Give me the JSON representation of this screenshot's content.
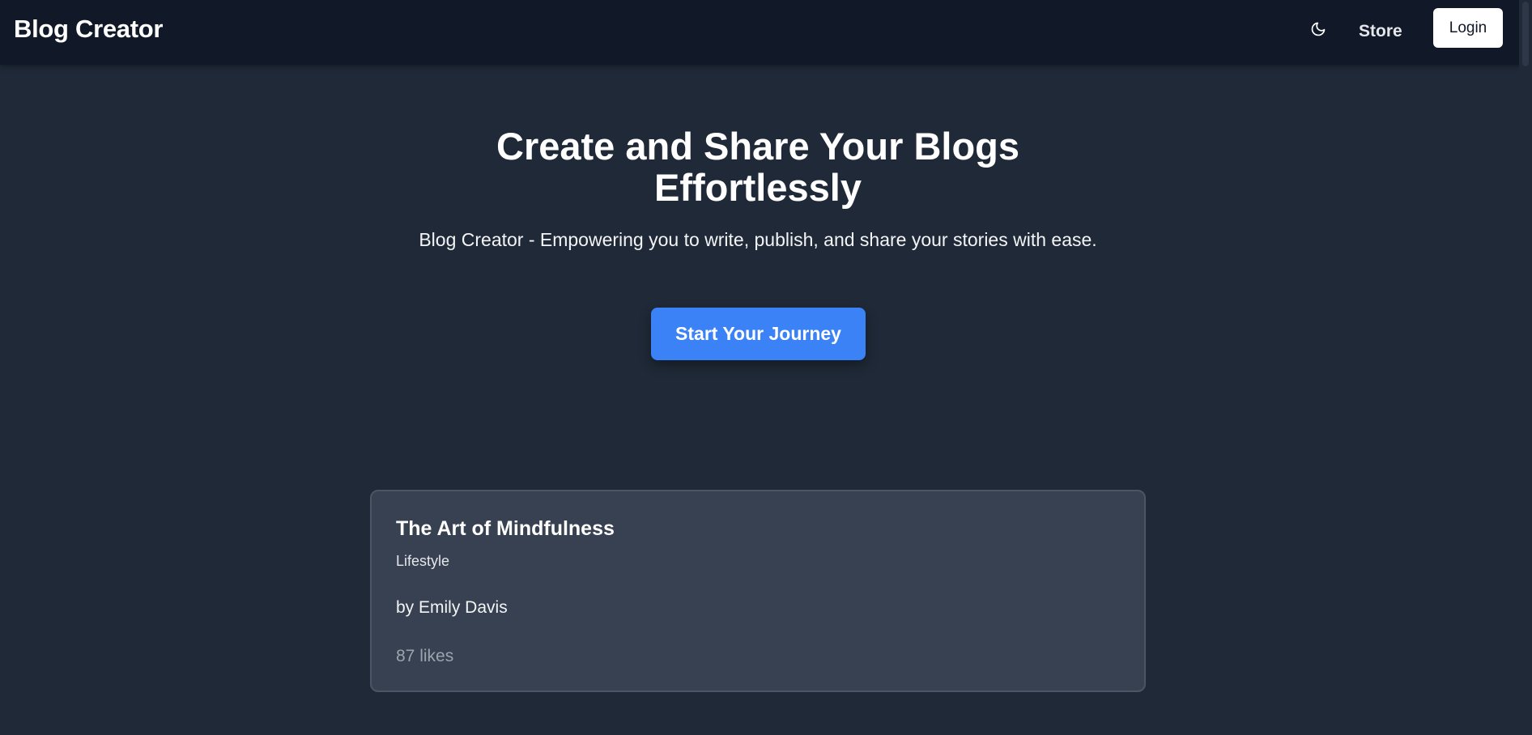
{
  "navbar": {
    "brand": "Blog Creator",
    "theme_toggle_icon": "moon-icon",
    "store_label": "Store",
    "login_label": "Login"
  },
  "hero": {
    "title": "Create and Share Your Blogs Effortlessly",
    "subtitle": "Blog Creator - Empowering you to write, publish, and share your stories with ease.",
    "cta_label": "Start Your Journey"
  },
  "blogs": [
    {
      "title": "The Art of Mindfulness",
      "category": "Lifestyle",
      "author": "by Emily Davis",
      "likes": "87 likes"
    }
  ],
  "colors": {
    "background": "#1f2937",
    "navbar": "#111827",
    "accent": "#3b82f6",
    "card": "#374151"
  }
}
